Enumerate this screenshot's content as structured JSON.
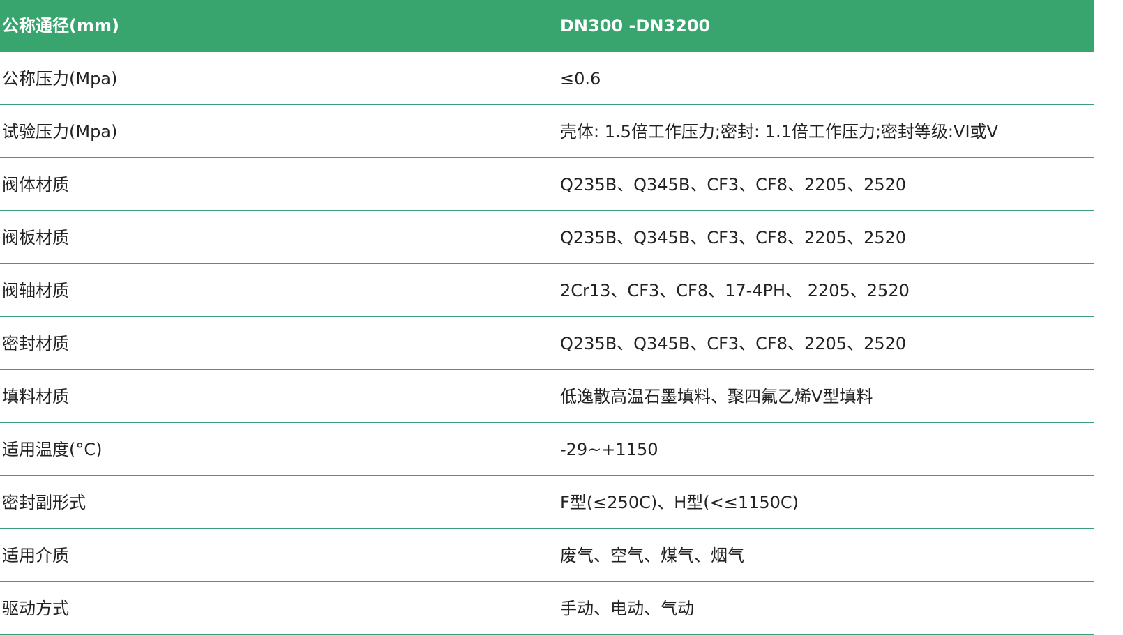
{
  "header": {
    "label": "公称通径(mm)",
    "value": "DN300 -DN3200"
  },
  "rows": [
    {
      "label": "公称压力(Mpa)",
      "value": "≤0.6"
    },
    {
      "label": "试验压力(Mpa)",
      "value": "壳体: 1.5倍工作压力;密封: 1.1倍工作压力;密封等级:VI或V"
    },
    {
      "label": "阀体材质",
      "value": "Q235B、Q345B、CF3、CF8、2205、2520"
    },
    {
      "label": "阀板材质",
      "value": "Q235B、Q345B、CF3、CF8、2205、2520"
    },
    {
      "label": "阀轴材质",
      "value": "2Cr13、CF3、CF8、17-4PH、 2205、2520"
    },
    {
      "label": "密封材质",
      "value": "Q235B、Q345B、CF3、CF8、2205、2520"
    },
    {
      "label": "填料材质",
      "value": "低逸散高温石墨填料、聚四氟乙烯V型填料"
    },
    {
      "label": "适用温度(°C)",
      "value": "-29~+1150"
    },
    {
      "label": "密封副形式",
      "value": "F型(≤250C)、H型(<≤1150C)"
    },
    {
      "label": "适用介质",
      "value": "废气、空气、煤气、烟气"
    },
    {
      "label": "驱动方式",
      "value": "手动、电动、气动"
    }
  ]
}
